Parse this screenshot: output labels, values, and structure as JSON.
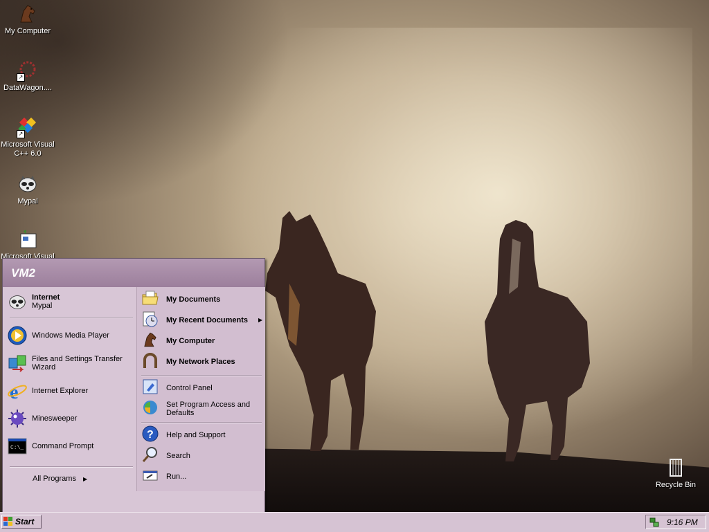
{
  "desktop": {
    "icons": [
      {
        "label": "My Computer",
        "icon": "horse-computer-icon"
      },
      {
        "label": "DataWagon....",
        "icon": "datawagon-icon"
      },
      {
        "label": "Microsoft Visual C++ 6.0",
        "icon": "visual-cpp-icon"
      },
      {
        "label": "Mypal",
        "icon": "mypal-raccoon-icon"
      },
      {
        "label": "Microsoft Visual ...",
        "icon": "visual-tool-icon"
      }
    ],
    "recycle_bin": {
      "label": "Recycle Bin",
      "icon": "recycle-bin-icon"
    }
  },
  "start_menu": {
    "user": "VM2",
    "left_items": [
      {
        "title": "Internet",
        "subtitle": "Mypal",
        "icon": "mypal-raccoon-icon"
      },
      {
        "title": "Windows Media Player",
        "icon": "media-player-icon"
      },
      {
        "title": "Files and Settings Transfer Wizard",
        "icon": "transfer-wizard-icon"
      },
      {
        "title": "Internet Explorer",
        "icon": "internet-explorer-icon"
      },
      {
        "title": "Minesweeper",
        "icon": "minesweeper-icon"
      },
      {
        "title": "Command Prompt",
        "icon": "command-prompt-icon"
      }
    ],
    "all_programs": "All Programs",
    "right_items": [
      {
        "title": "My Documents",
        "icon": "folder-documents-icon"
      },
      {
        "title": "My Recent Documents",
        "icon": "recent-documents-icon"
      },
      {
        "title": "My Computer",
        "icon": "horse-computer-icon"
      },
      {
        "title": "My Network Places",
        "icon": "network-horseshoe-icon"
      },
      {
        "title": "Control Panel",
        "icon": "control-panel-icon"
      },
      {
        "title": "Set Program Access and Defaults",
        "icon": "program-defaults-icon"
      },
      {
        "title": "Help and Support",
        "icon": "help-icon"
      },
      {
        "title": "Search",
        "icon": "search-icon"
      },
      {
        "title": "Run...",
        "icon": "run-icon"
      }
    ]
  },
  "taskbar": {
    "start_label": "Start",
    "clock": "9:16 PM"
  }
}
